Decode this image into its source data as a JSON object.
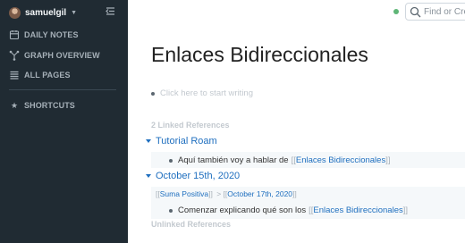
{
  "sidebar": {
    "user": "samuelgil",
    "nav": [
      {
        "icon": "calendar-icon",
        "label": "DAILY NOTES"
      },
      {
        "icon": "graph-icon",
        "label": "GRAPH OVERVIEW"
      },
      {
        "icon": "list-icon",
        "label": "ALL PAGES"
      }
    ],
    "shortcuts_label": "SHORTCUTS"
  },
  "topbar": {
    "status_color": "#5fb677",
    "search_placeholder": "Find or Create Page"
  },
  "page": {
    "title": "Enlaces Bidireccionales",
    "placeholder": "Click here to start writing",
    "linked_refs_label": "2 Linked References",
    "unlinked_refs_label": "Unlinked References",
    "references": [
      {
        "page": "Tutorial Roam",
        "text": "Aquí también voy a hablar de",
        "link": "Enlaces Bidireccionales"
      },
      {
        "page": "October 15th, 2020",
        "crumbs": [
          "Suma Positiva",
          "October 17th, 2020"
        ],
        "text": "Comenzar explicando qué son los",
        "link": "Enlaces Bidireccionales"
      }
    ]
  },
  "colors": {
    "sidebar_bg": "#202b33",
    "link": "#1f6fbf"
  }
}
